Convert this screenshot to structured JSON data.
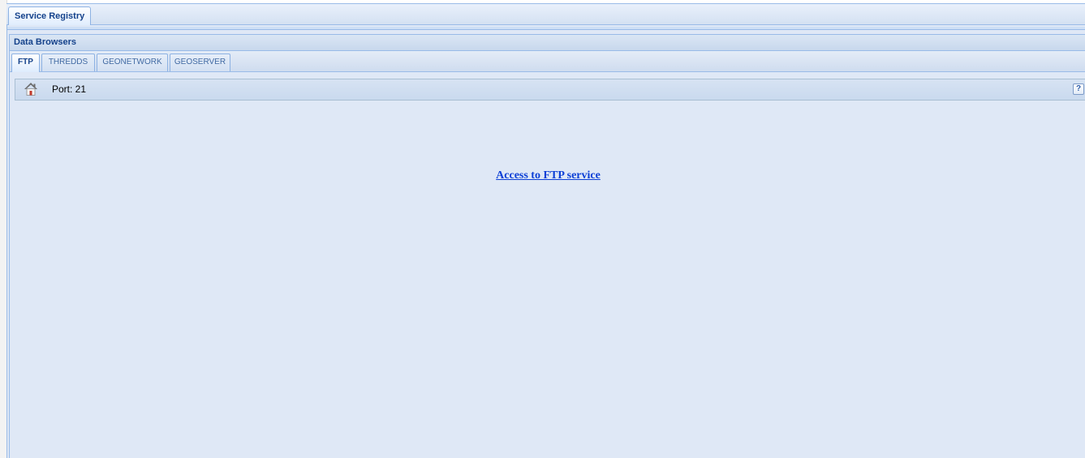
{
  "outer_tabs": [
    {
      "label": "Service Registry",
      "active": true
    }
  ],
  "panel": {
    "title": "Data Browsers"
  },
  "inner_tabs": [
    {
      "label": "FTP",
      "active": true
    },
    {
      "label": "THREDDS",
      "active": false
    },
    {
      "label": "GEONETWORK",
      "active": false
    },
    {
      "label": "GEOSERVER",
      "active": false
    }
  ],
  "toolbar": {
    "home_icon": "home-icon",
    "port_label": "Port: 21",
    "help_icon_label": "?"
  },
  "content": {
    "link_text": "Access to FTP service"
  },
  "colors": {
    "accent": "#15428b",
    "panel_bg": "#dfe8f6",
    "border": "#99bbe8",
    "link": "#0b3fd6"
  }
}
